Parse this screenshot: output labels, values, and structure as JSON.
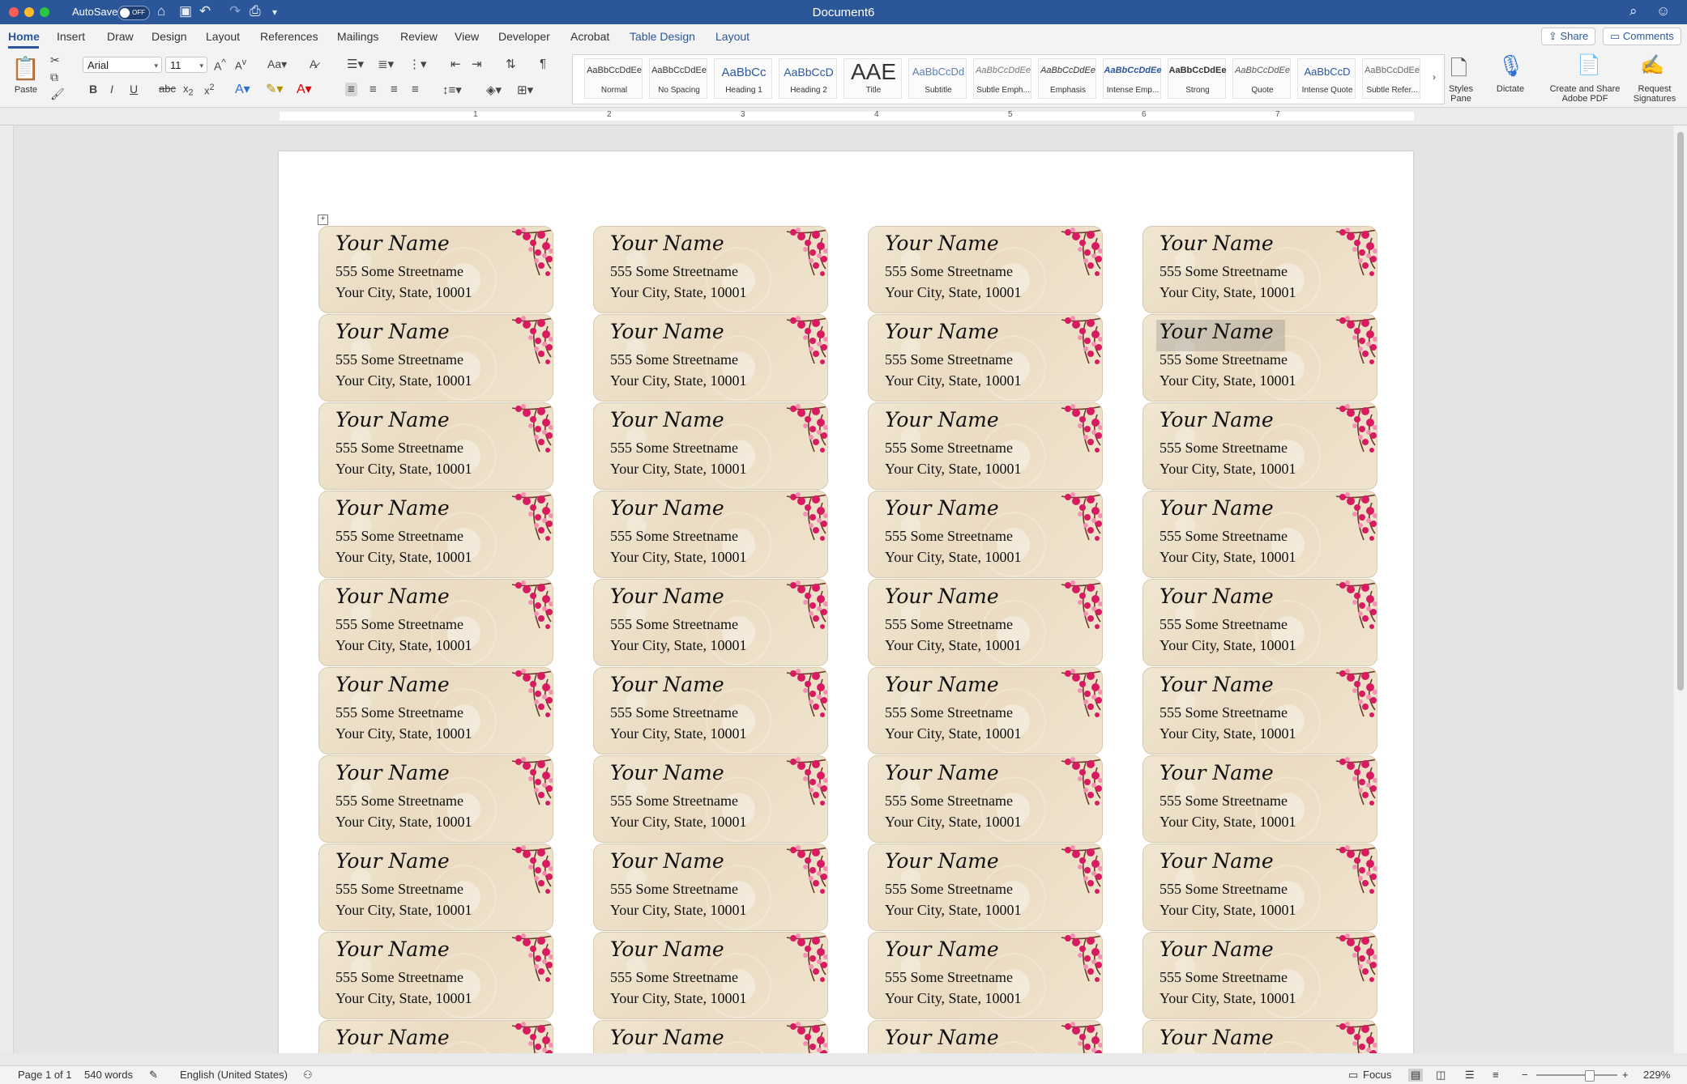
{
  "window": {
    "title": "Document6",
    "autosave_label": "AutoSave",
    "autosave_state": "OFF"
  },
  "tabs": [
    "Home",
    "Insert",
    "Draw",
    "Design",
    "Layout",
    "References",
    "Mailings",
    "Review",
    "View",
    "Developer",
    "Acrobat",
    "Table Design",
    "Layout"
  ],
  "share": {
    "share_label": "Share",
    "comments_label": "Comments"
  },
  "ribbon": {
    "paste_label": "Paste",
    "font_name": "Arial",
    "font_size": "11",
    "styles": [
      {
        "preview": "AaBbCcDdEe",
        "name": "Normal"
      },
      {
        "preview": "AaBbCcDdEe",
        "name": "No Spacing"
      },
      {
        "preview": "AaBbCc",
        "name": "Heading 1"
      },
      {
        "preview": "AaBbCcD",
        "name": "Heading 2"
      },
      {
        "preview": "AAE",
        "name": "Title"
      },
      {
        "preview": "AaBbCcDd",
        "name": "Subtitle"
      },
      {
        "preview": "AaBbCcDdEe",
        "name": "Subtle Emph..."
      },
      {
        "preview": "AaBbCcDdEe",
        "name": "Emphasis"
      },
      {
        "preview": "AaBbCcDdEe",
        "name": "Intense Emp..."
      },
      {
        "preview": "AaBbCcDdEe",
        "name": "Strong"
      },
      {
        "preview": "AaBbCcDdEe",
        "name": "Quote"
      },
      {
        "preview": "AaBbCcD",
        "name": "Intense Quote"
      },
      {
        "preview": "AaBbCcDdEe",
        "name": "Subtle Refer..."
      }
    ],
    "styles_pane_label": "Styles Pane",
    "dictate_label": "Dictate",
    "create_pdf_label": "Create and Share Adobe PDF",
    "request_sig_label": "Request Signatures"
  },
  "ruler_numbers": [
    "1",
    "2",
    "3",
    "4",
    "5",
    "6",
    "7"
  ],
  "label": {
    "name": "Your Name",
    "street": "555 Some Streetname",
    "city": "Your City, State, 10001"
  },
  "status": {
    "page": "Page 1 of 1",
    "words": "540 words",
    "language": "English (United States)",
    "focus_label": "Focus",
    "zoom": "229%"
  },
  "colors": {
    "title_bar": "#2b579a",
    "accent": "#2b579a",
    "label_bg": "#eadbc1",
    "flower": "#c2185b"
  }
}
